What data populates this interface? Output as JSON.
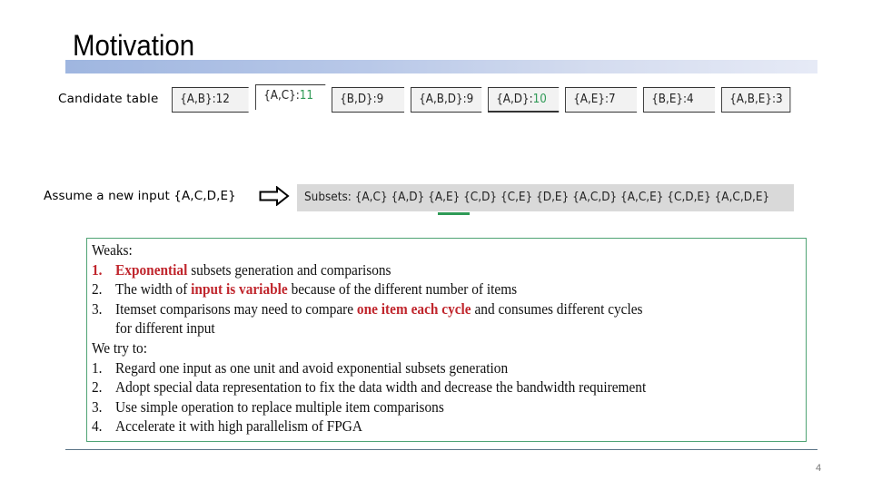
{
  "slide": {
    "title": "Motivation",
    "page_number": "4"
  },
  "candidate_table": {
    "label": "Candidate table",
    "cells": [
      {
        "set": "{A,B}:",
        "count": "12",
        "highlighted": false,
        "count_color": "default"
      },
      {
        "set": "{A,C}:",
        "count": "11",
        "highlighted": true,
        "count_color": "#2f9a56"
      },
      {
        "set": "{B,D}:",
        "count": "9",
        "highlighted": false,
        "count_color": "default"
      },
      {
        "set": "{A,B,D}:",
        "count": "9",
        "highlighted": false,
        "count_color": "default"
      },
      {
        "set": "{A,D}:",
        "count": "10",
        "highlighted": true,
        "count_color": "#2f9a56"
      },
      {
        "set": "{A,E}:",
        "count": "7",
        "highlighted": false,
        "count_color": "default"
      },
      {
        "set": "{B,E}:",
        "count": "4",
        "highlighted": false,
        "count_color": "default"
      },
      {
        "set": "{A,B,E}:",
        "count": "3",
        "highlighted": false,
        "count_color": "default"
      }
    ]
  },
  "input": {
    "label": "Assume a new input {A,C,D,E}",
    "arrow_icon": "right-arrow-outline",
    "subsets_text": "Subsets: {A,C} {A,D} {A,E} {C,D} {C,E} {D,E} {A,C,D} {A,C,E} {C,D,E} {A,C,D,E}"
  },
  "weaks": {
    "heading": "Weaks:",
    "items": [
      {
        "num": "1.",
        "pre": "",
        "highlight": "Exponential",
        "post": " subsets generation and comparisons",
        "num_red": true
      },
      {
        "num": "2.",
        "pre": "The width of ",
        "highlight": "input is variable",
        "post": " because of the different number of items",
        "num_red": false
      },
      {
        "num": "3.",
        "pre": "Itemset comparisons may need to compare ",
        "highlight": "one item each cycle",
        "post": " and consumes different cycles",
        "num_red": false,
        "continuation": "for different input"
      }
    ]
  },
  "we_try": {
    "heading": "We try to:",
    "items": [
      {
        "num": "1.",
        "text": "Regard one input as one unit and avoid exponential subsets generation"
      },
      {
        "num": "2.",
        "text": "Adopt special data representation to fix the data width and decrease the bandwidth requirement"
      },
      {
        "num": "3.",
        "text": "Use simple operation to replace multiple item comparisons"
      },
      {
        "num": "4.",
        "text": "Accelerate it with high parallelism of FPGA"
      }
    ]
  },
  "colors": {
    "highlight_red": "#c0262d",
    "highlight_green": "#2f9a56",
    "box_border": "#4fa374"
  }
}
